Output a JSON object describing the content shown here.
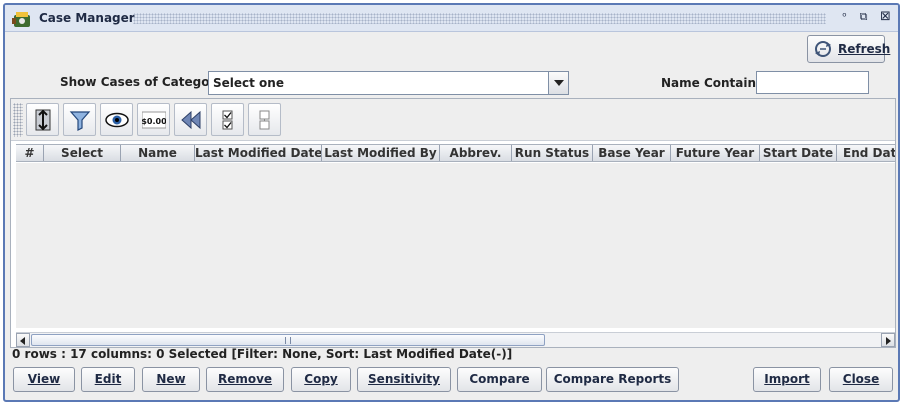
{
  "window": {
    "title": "Case Manager",
    "controls": {
      "minimize": "ᵒ",
      "maximize": "⧉",
      "close": "⊠"
    }
  },
  "refresh": {
    "label": "Refresh"
  },
  "filter": {
    "category_label": "Show Cases of Category:",
    "category_value": "Select one",
    "name_label": "Name Contains:",
    "name_value": ""
  },
  "toolbar": {
    "icons": [
      "sort-rows-icon",
      "filter-icon",
      "view-columns-icon",
      "format-currency-icon",
      "reset-icon",
      "select-all-icon",
      "clear-selection-icon"
    ],
    "currency_text": "$0.00"
  },
  "table": {
    "columns": [
      "#",
      "Select",
      "Name",
      "Last Modified Date",
      "Last Modified By",
      "Abbrev.",
      "Run Status",
      "Base Year",
      "Future Year",
      "Start Date",
      "End Date"
    ],
    "rows": []
  },
  "status": {
    "text": "0 rows : 17 columns: 0 Selected [Filter: None, Sort: Last Modified Date(-)]"
  },
  "buttons": {
    "view": "View",
    "edit": "Edit",
    "new": "New",
    "remove": "Remove",
    "copy": "Copy",
    "sensitivity": "Sensitivity",
    "compare": "Compare",
    "compare_reports": "Compare Reports",
    "import": "Import",
    "close": "Close"
  },
  "colors": {
    "window_border": "#5b79b5",
    "titlebar_bg": "#dfe6f2",
    "panel_bg": "#eeeeee"
  }
}
